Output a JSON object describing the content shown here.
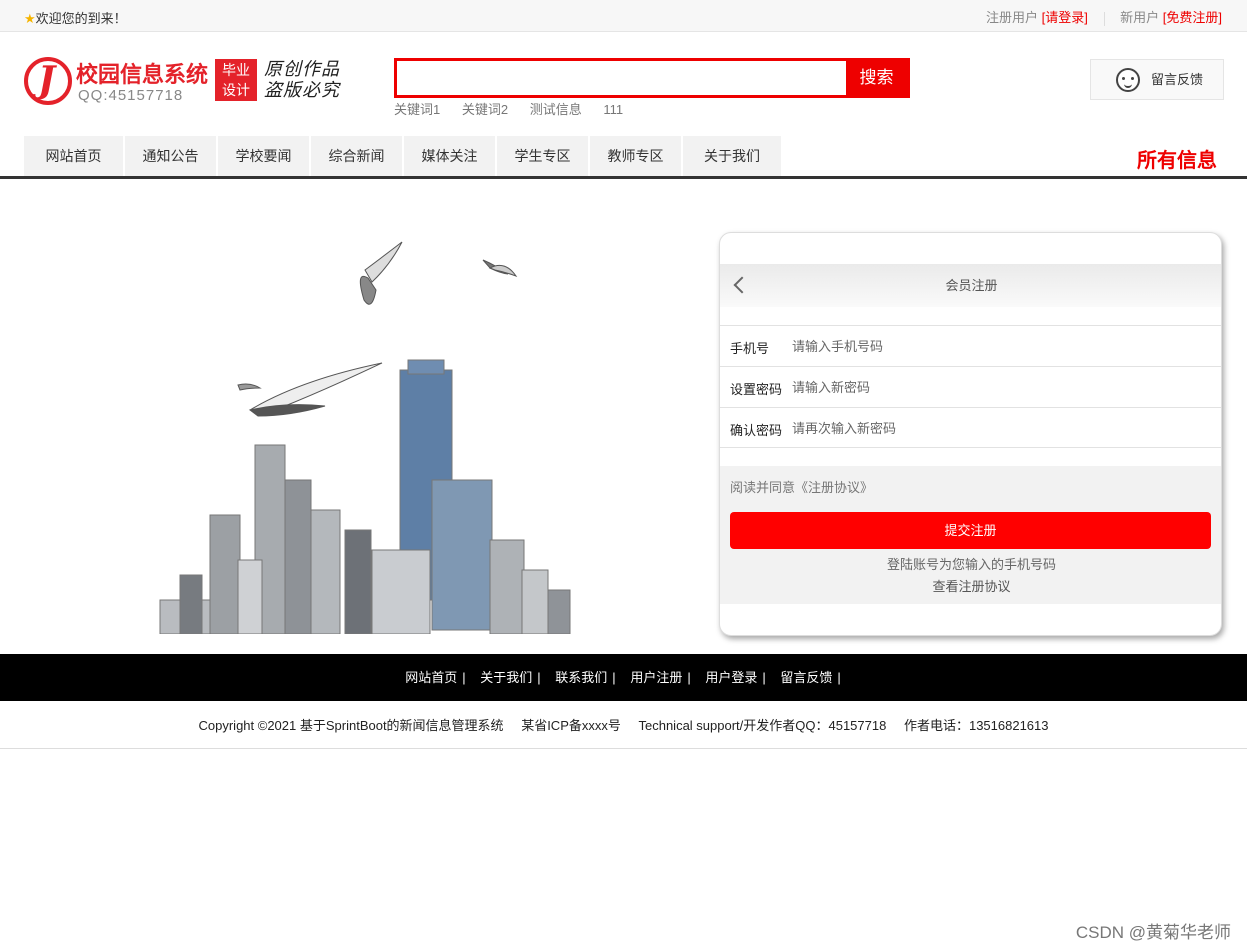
{
  "topbar": {
    "welcome": "欢迎您的到来！",
    "register_user_label": "注册用户",
    "login_link": "[请登录]",
    "new_user_label": "新用户",
    "free_register_link": "[免费注册]"
  },
  "logo": {
    "name": "校园信息系统",
    "qq": "QQ:45157718",
    "badge_line1": "毕业",
    "badge_line2": "设计",
    "slogan_line1": "原创作品",
    "slogan_line2": "盗版必究"
  },
  "search": {
    "button": "搜索",
    "value": "",
    "keywords": [
      "关键词1",
      "关键词2",
      "测试信息",
      "111"
    ]
  },
  "feedback": {
    "label": "留言反馈"
  },
  "nav": {
    "items": [
      "网站首页",
      "通知公告",
      "学校要闻",
      "综合新闻",
      "媒体关注",
      "学生专区",
      "教师专区",
      "关于我们"
    ],
    "all_info": "所有信息"
  },
  "register": {
    "title": "会员注册",
    "fields": [
      {
        "label": "手机号",
        "placeholder": "请输入手机号码"
      },
      {
        "label": "设置密码",
        "placeholder": "请输入新密码"
      },
      {
        "label": "确认密码",
        "placeholder": "请再次输入新密码"
      }
    ],
    "agree": "阅读并同意《注册协议》",
    "submit": "提交注册",
    "hint": "登陆账号为您输入的手机号码",
    "view_agreement": "查看注册协议"
  },
  "footer": {
    "links": [
      "网站首页",
      "关于我们",
      "联系我们",
      "用户注册",
      "用户登录",
      "留言反馈"
    ],
    "separator": "|",
    "copyright": "Copyright ©2021 基于SprintBoot的新闻信息管理系统",
    "icp": "某省ICP备xxxx号",
    "support": "Technical support/开发作者QQ：45157718",
    "phone": "作者电话：13516821613"
  },
  "watermark": "CSDN @黄菊华老师",
  "colors": {
    "accent": "#e00000",
    "nav_bg": "#f2f2f2",
    "footer_bg": "#000000"
  }
}
